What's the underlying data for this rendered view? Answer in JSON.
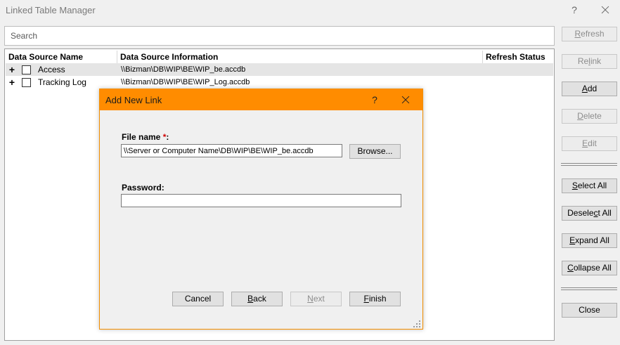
{
  "window": {
    "title": "Linked Table Manager",
    "help_glyph": "?",
    "search_placeholder": "Search"
  },
  "columns": [
    "Data Source Name",
    "Data Source Information",
    "Refresh Status"
  ],
  "rows": [
    {
      "expander": "+",
      "name": "Access",
      "info": "\\\\Bizman\\DB\\WIP\\BE\\WIP_be.accdb",
      "status": "",
      "selected": true
    },
    {
      "expander": "+",
      "name": "Tracking Log",
      "info": "\\\\Bizman\\DB\\WIP\\BE\\WIP_Log.accdb",
      "status": "",
      "selected": false
    }
  ],
  "side_buttons": {
    "refresh": {
      "pre": "",
      "key": "R",
      "post": "efresh",
      "enabled": false
    },
    "relink": {
      "pre": "Re",
      "key": "l",
      "post": "ink",
      "enabled": false
    },
    "add": {
      "pre": "",
      "key": "A",
      "post": "dd",
      "enabled": true
    },
    "delete": {
      "pre": "",
      "key": "D",
      "post": "elete",
      "enabled": false
    },
    "edit": {
      "pre": "",
      "key": "E",
      "post": "dit",
      "enabled": false
    },
    "select_all": {
      "pre": "",
      "key": "S",
      "post": "elect All",
      "enabled": true
    },
    "deselect_all": {
      "pre": "Desele",
      "key": "c",
      "post": "t All",
      "enabled": true
    },
    "expand_all": {
      "pre": "",
      "key": "E",
      "post": "xpand All",
      "enabled": true
    },
    "collapse_all": {
      "pre": "",
      "key": "C",
      "post": "ollapse All",
      "enabled": true
    },
    "close": {
      "label": "Close",
      "enabled": true
    }
  },
  "dialog": {
    "title": "Add New Link",
    "help_glyph": "?",
    "title_color": "#ff8c00",
    "file_name_label": "File name",
    "required_marker": "*",
    "label_colon": ":",
    "file_name_value": "\\\\Server or Computer Name\\DB\\WIP\\BE\\WIP_be.accdb",
    "browse_label": "Browse...",
    "password_label": "Password:",
    "password_value": "",
    "buttons": {
      "cancel": {
        "label": "Cancel",
        "enabled": true
      },
      "back": {
        "key": "B",
        "post": "ack",
        "enabled": true
      },
      "next": {
        "key": "N",
        "post": "ext",
        "enabled": false
      },
      "finish": {
        "key": "F",
        "post": "inish",
        "enabled": true
      }
    }
  },
  "icons": {
    "title_help": "question-mark-icon",
    "title_close": "close-icon",
    "expander": "plus-icon",
    "checkbox": "checkbox-icon",
    "resize": "resize-grip-icon"
  }
}
